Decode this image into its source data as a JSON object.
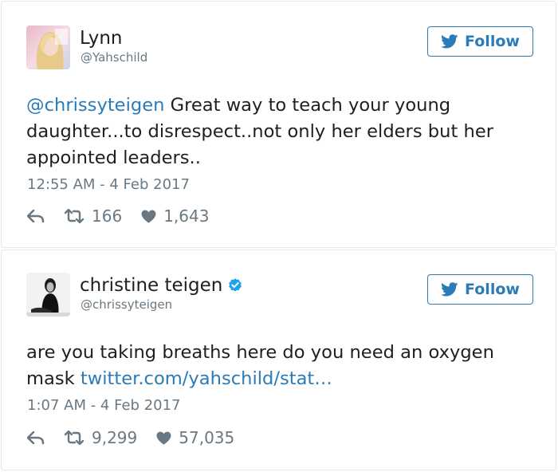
{
  "tweets": [
    {
      "author": {
        "name": "Lynn",
        "handle": "@Yahschild",
        "verified": false,
        "avatar": "woman-portrait-photo"
      },
      "follow_label": "Follow",
      "text_mention": "@chrissyteigen",
      "text_body": " Great way to teach your young daughter...to disrespect..not only her elders but her appointed leaders..",
      "timestamp": "12:55 AM - 4 Feb 2017",
      "actions": {
        "reply_icon": "reply-icon",
        "retweets": "166",
        "likes": "1,643"
      }
    },
    {
      "author": {
        "name": "christine teigen",
        "handle": "@chrissyteigen",
        "verified": true,
        "avatar": "woman-bw-portrait-photo"
      },
      "follow_label": "Follow",
      "text_body": "are you taking breaths here do you need an oxygen mask ",
      "text_link": "twitter.com/yahschild/stat…",
      "timestamp": "1:07 AM - 4 Feb 2017",
      "actions": {
        "reply_icon": "reply-icon",
        "retweets": "9,299",
        "likes": "57,035"
      }
    }
  ],
  "colors": {
    "link": "#2b7bb9",
    "text": "#1c2022",
    "muted": "#697882",
    "border": "#e1e8ed",
    "verified": "#1da1f2"
  }
}
